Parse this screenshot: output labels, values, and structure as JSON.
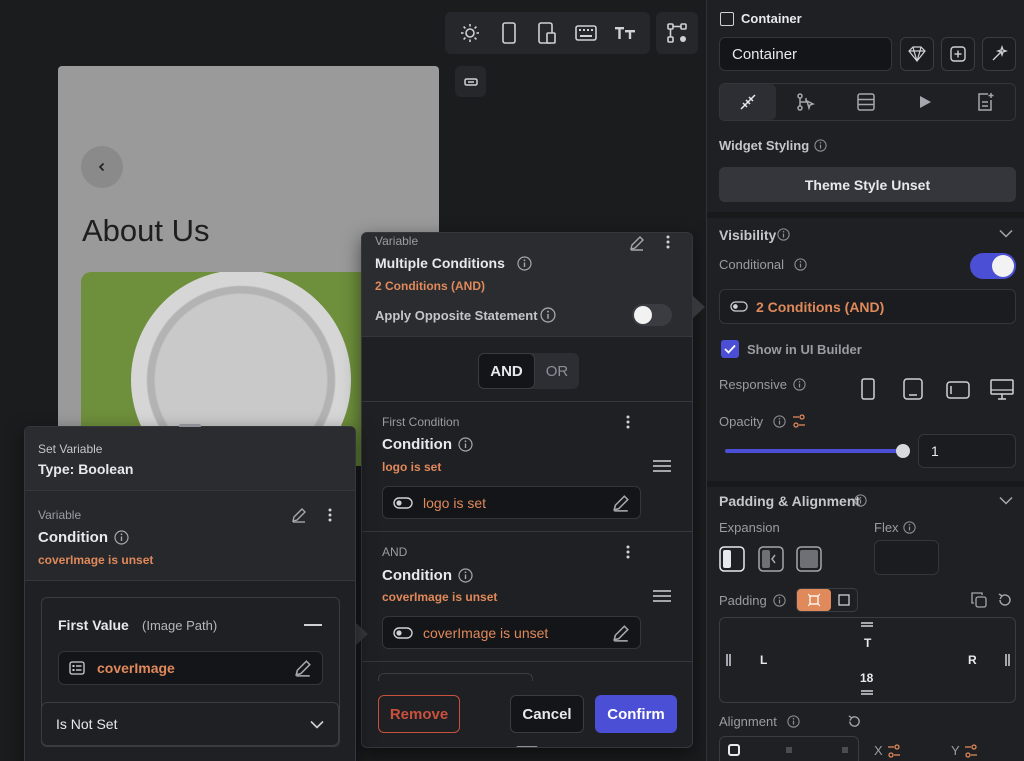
{
  "toolbar": {
    "icons": [
      "sun-icon",
      "phone-icon",
      "tablet-icon",
      "keyboard-icon",
      "text-size-icon",
      "branch-settings-icon"
    ]
  },
  "canvas": {
    "page_title": "About Us"
  },
  "multi_condition": {
    "header_label": "Variable",
    "title": "Multiple Conditions",
    "subtitle": "2 Conditions (AND)",
    "apply_opposite_label": "Apply Opposite Statement",
    "and_label": "AND",
    "or_label": "OR",
    "first": {
      "section_label": "First Condition",
      "title": "Condition",
      "subtitle": "logo is set",
      "value": "logo is set"
    },
    "second": {
      "section_label": "AND",
      "title": "Condition",
      "subtitle": "coverImage is unset",
      "value": "coverImage is unset"
    },
    "remove_label": "Remove",
    "cancel_label": "Cancel",
    "confirm_label": "Confirm"
  },
  "set_variable": {
    "title": "Set Variable",
    "type": "Type: Boolean",
    "var_label": "Variable",
    "condition_title": "Condition",
    "condition_subtitle": "coverImage is unset",
    "first_value_label": "First Value",
    "first_value_type": "(Image Path)",
    "first_value": "coverImage",
    "operator": "Is Not Set"
  },
  "sidebar": {
    "widget_checkbox_label": "Container",
    "widget_name": "Container",
    "widget_styling_label": "Widget Styling",
    "theme_style_button": "Theme Style Unset",
    "visibility_title": "Visibility",
    "conditional_label": "Conditional",
    "conditional_value": "2 Conditions (AND)",
    "show_in_builder_label": "Show in UI Builder",
    "responsive_label": "Responsive",
    "opacity_label": "Opacity",
    "opacity_value": "1",
    "opacity_fraction": 1.0,
    "padding_alignment_title": "Padding & Alignment",
    "expansion_label": "Expansion",
    "flex_label": "Flex",
    "padding_label": "Padding",
    "padding_top_label": "T",
    "padding_left_label": "L",
    "padding_right_label": "R",
    "padding_bottom_value": "18",
    "alignment_label": "Alignment",
    "align_x_label": "X",
    "align_y_label": "Y"
  },
  "colors": {
    "accent": "#4b4fd6",
    "orange": "#e0895a",
    "danger": "#c9503c"
  }
}
